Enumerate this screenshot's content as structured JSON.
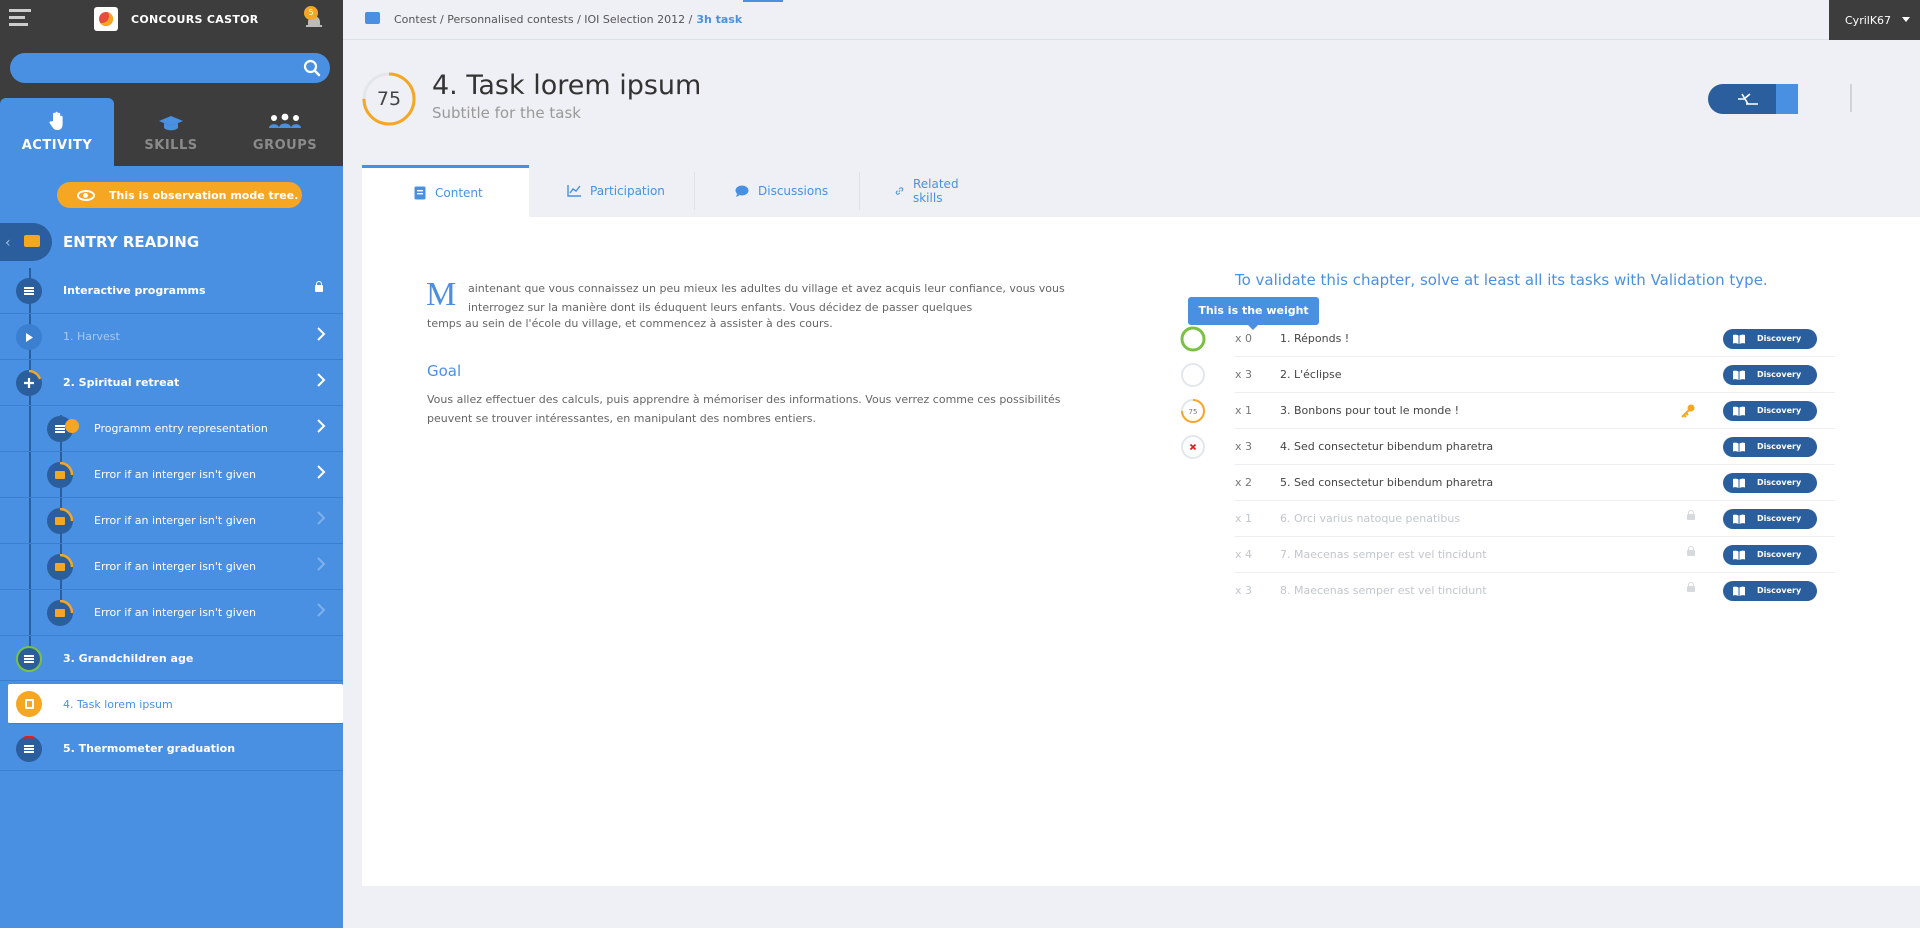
{
  "sidebar": {
    "app_title": "CONCOURS CASTOR",
    "notification_count": "5",
    "search_placeholder": "",
    "tabs": [
      {
        "label": "ACTIVITY",
        "icon": "hand-icon",
        "active": true
      },
      {
        "label": "SKILLS",
        "icon": "graduation-cap-icon",
        "active": false
      },
      {
        "label": "GROUPS",
        "icon": "people-icon",
        "active": false
      }
    ],
    "observation_banner": "This is observation mode tree.",
    "chapter_title": "ENTRY READING",
    "items": [
      {
        "label": "Interactive programms",
        "icon": "list-icon",
        "locked": true
      },
      {
        "label": "1. Harvest",
        "icon": "play-icon"
      },
      {
        "label": "2. Spiritual retreat",
        "icon": "plus-icon"
      },
      {
        "label": "Programm entry representation",
        "icon": "list-icon"
      },
      {
        "label": "Error if an interger isn't given",
        "icon": "folder-icon"
      },
      {
        "label": "Error if an interger isn't given",
        "icon": "folder-icon"
      },
      {
        "label": "Error if an interger isn't given",
        "icon": "folder-icon"
      },
      {
        "label": "Error if an interger isn't given",
        "icon": "folder-icon"
      },
      {
        "label": "3. Grandchildren age",
        "icon": "list-icon"
      },
      {
        "label": "4. Task lorem ipsum",
        "icon": "task-icon",
        "selected": true
      },
      {
        "label": "5. Thermometer graduation",
        "icon": "list-icon"
      }
    ]
  },
  "topbar": {
    "breadcrumb": "Contest / Personnalised contests / IOI Selection 2012 /",
    "breadcrumb_current": "3h task",
    "user": "CyrilK67"
  },
  "task": {
    "score": "75",
    "score_progress": 0.75,
    "title": "4. Task lorem ipsum",
    "subtitle": "Subtitle for the task"
  },
  "tabs": [
    {
      "label": "Content",
      "icon": "document-icon",
      "active": true
    },
    {
      "label": "Participation",
      "icon": "chart-icon"
    },
    {
      "label": "Discussions",
      "icon": "chat-icon"
    },
    {
      "label": "Related skills",
      "icon": "link-icon"
    }
  ],
  "content": {
    "dropcap": "M",
    "intro_line1": "aintenant que vous connaissez un peu mieux les adultes du village et avez acquis leur confiance, vous vous interrogez sur la manière dont ils éduquent leurs enfants. Vous décidez de passer quelques",
    "intro_line2": "temps au sein de l'école du village, et commencez à assister à des cours.",
    "goal_title": "Goal",
    "goal_text": "Vous allez effectuer des calculs, puis apprendre à mémoriser des informations. Vous verrez comme ces possibilités peuvent se trouver intéressantes, en manipulant des nombres entiers.",
    "validate_text": "To validate this chapter, solve at least all its tasks with Validation type.",
    "weight_tooltip": "This is the weight",
    "tasks": [
      {
        "weight": "x 0",
        "name": "1. Réponds !",
        "status": "complete",
        "button": "Discovery"
      },
      {
        "weight": "x 3",
        "name": "2. L'éclipse",
        "status": "empty",
        "button": "Discovery"
      },
      {
        "weight": "x 1",
        "name": "3. Bonbons pour tout le monde !",
        "status": "partial",
        "score": "75",
        "key": true,
        "button": "Discovery"
      },
      {
        "weight": "x 3",
        "name": "4. Sed consectetur bibendum pharetra",
        "status": "failed",
        "button": "Discovery"
      },
      {
        "weight": "x 2",
        "name": "5. Sed consectetur bibendum pharetra",
        "status": "none",
        "button": "Discovery"
      },
      {
        "weight": "x 1",
        "name": "6. Orci varius natoque penatibus",
        "status": "locked",
        "button": "Discovery"
      },
      {
        "weight": "x 4",
        "name": "7. Maecenas semper est vel tincidunt",
        "status": "locked",
        "button": "Discovery"
      },
      {
        "weight": "x 3",
        "name": "8. Maecenas semper est vel tincidunt",
        "status": "locked",
        "button": "Discovery"
      }
    ]
  },
  "colors": {
    "accent": "#4a90e2",
    "dark_blue": "#2b5e9c",
    "orange": "#f5a623",
    "sidebar_dark": "#3d3d3d",
    "green": "#7ac143",
    "red": "#e02020"
  }
}
